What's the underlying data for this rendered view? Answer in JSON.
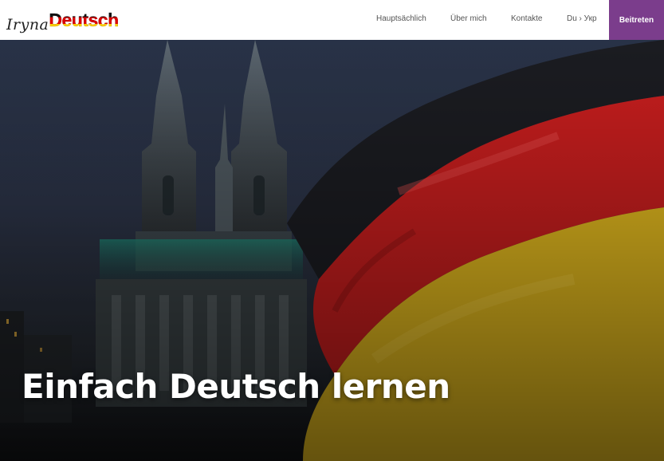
{
  "logo": {
    "script_text": "Iryna",
    "word_text": "Deutsch"
  },
  "nav": {
    "items": [
      {
        "label": "Hauptsächlich"
      },
      {
        "label": "Über mich"
      },
      {
        "label": "Kontakte"
      },
      {
        "label": "Du › Укр"
      }
    ],
    "join_label": "Beitreten"
  },
  "hero": {
    "title": "Einfach Deutsch lernen",
    "image_subject": "Cologne cathedral with waving German flag",
    "flag_colors": [
      "#1b1c21",
      "#c81e1e",
      "#e1b81e"
    ]
  },
  "colors": {
    "accent": "#7b3d8c",
    "nav_text": "#555555"
  }
}
